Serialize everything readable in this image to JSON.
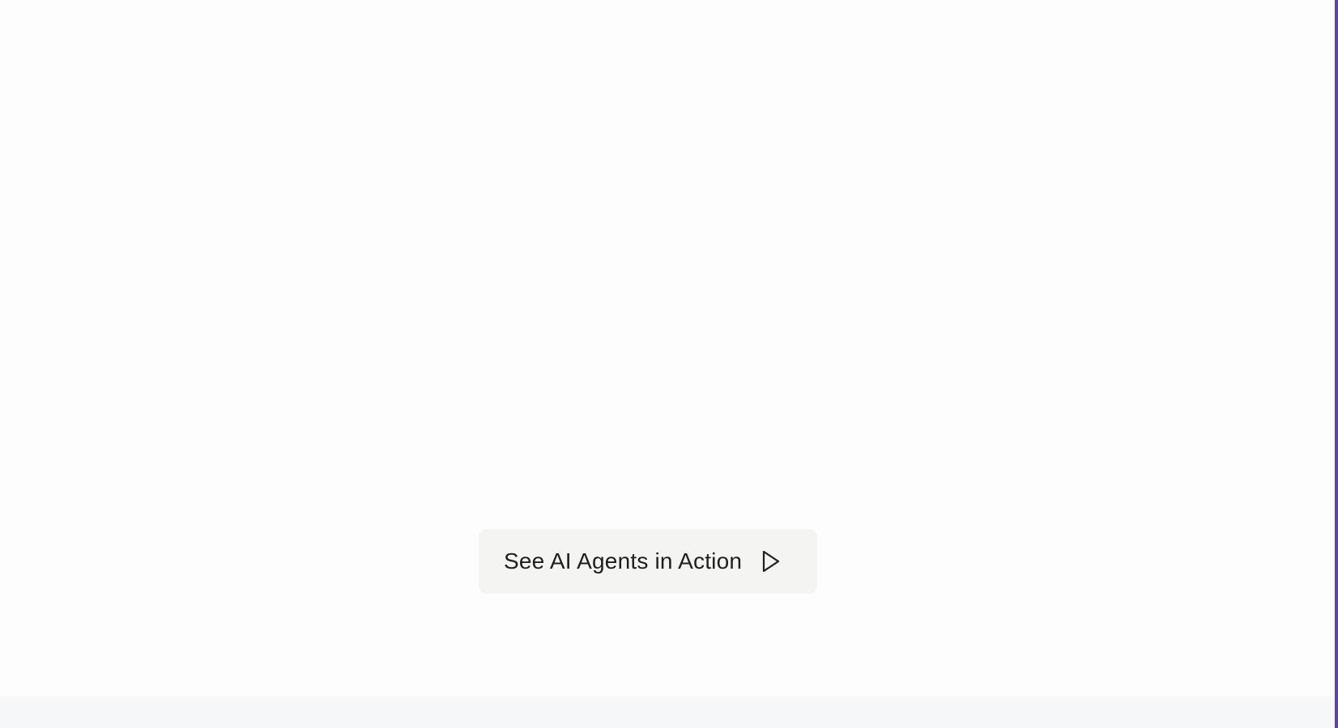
{
  "cta": {
    "label": "See AI Agents in Action",
    "icon": "play-icon"
  },
  "colors": {
    "page_background": "#fdfdfd",
    "button_background": "#f4f4f3",
    "text": "#1f1f1f",
    "bottom_strip": "#f6f7f9",
    "accent_edge": "#5b3ccf"
  }
}
